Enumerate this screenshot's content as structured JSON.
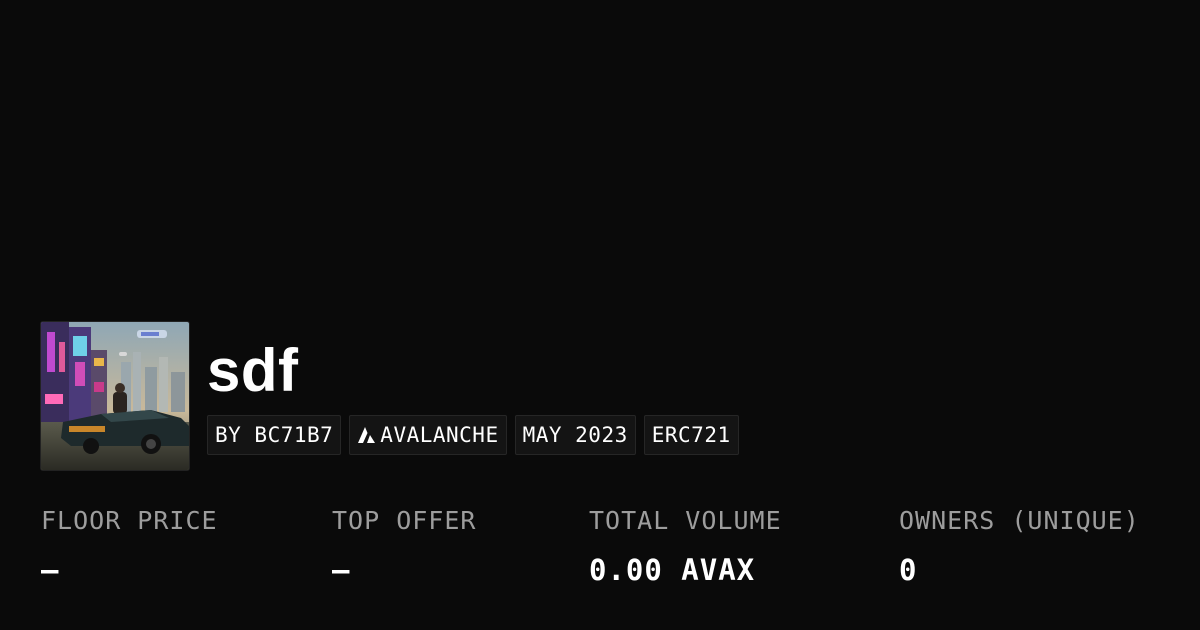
{
  "collection": {
    "name": "sdf",
    "image_description_icon": "collection-thumbnail"
  },
  "tags": {
    "creator": "BY BC71B7",
    "chain": "AVALANCHE",
    "chain_icon": "avalanche-logo-icon",
    "date": "MAY 2023",
    "standard": "ERC721"
  },
  "stats": {
    "floor_price": {
      "label": "FLOOR PRICE",
      "value": "–"
    },
    "top_offer": {
      "label": "TOP OFFER",
      "value": "–"
    },
    "total_volume": {
      "label": "TOTAL VOLUME",
      "value": "0.00 AVAX"
    },
    "owners": {
      "label": "OWNERS (UNIQUE)",
      "value": "0"
    }
  },
  "colors": {
    "background": "#0a0a0a",
    "label": "#9d9d9d",
    "text": "#ffffff",
    "tag_bg": "#141414"
  }
}
